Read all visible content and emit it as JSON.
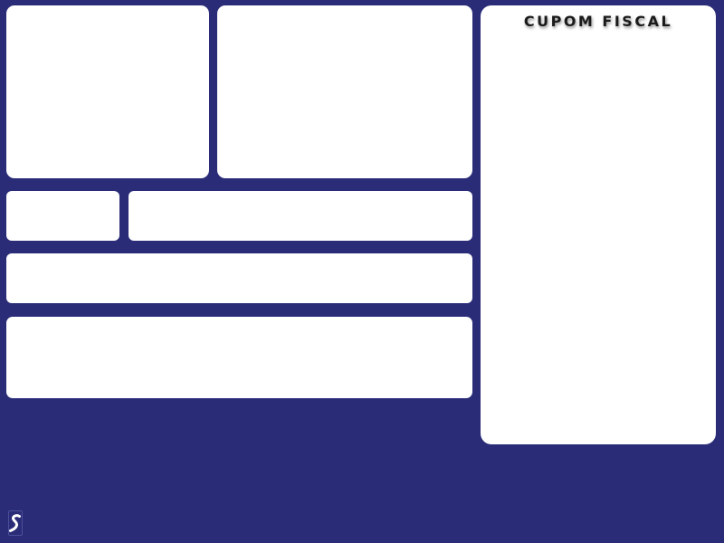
{
  "receipt": {
    "title": "CUPOM FISCAL"
  },
  "logo": {
    "icon": "s-logo-icon"
  },
  "colors": {
    "background": "#2a2c78",
    "panel": "#ffffff",
    "title_text": "#1a1a1a"
  }
}
